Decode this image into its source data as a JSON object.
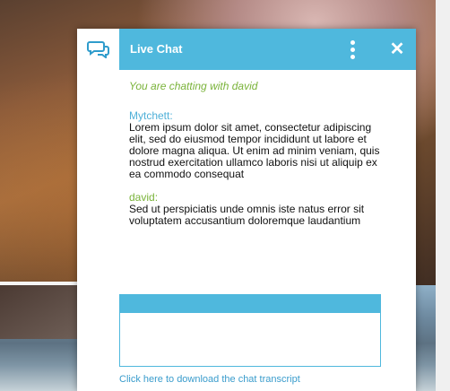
{
  "header": {
    "title": "Live Chat",
    "logo_icon": "chat-bubbles-icon",
    "menu_icon": "vertical-dots-icon",
    "close_icon": "close-icon",
    "close_glyph": "✕"
  },
  "chat": {
    "status": "You are chatting with david",
    "messages": [
      {
        "sender": "Mytchett:",
        "text": "Lorem ipsum dolor sit amet, consectetur adipiscing elit, sed do eiusmod tempor incididunt ut labore et dolore magna aliqua. Ut enim ad minim veniam, quis nostrud exercitation ullamco laboris nisi ut aliquip ex ea commodo consequat"
      },
      {
        "sender": "david:",
        "text": "Sed ut perspiciatis unde omnis iste natus error sit voluptatem accusantium doloremque laudantium"
      }
    ]
  },
  "input": {
    "placeholder": ""
  },
  "footer": {
    "transcript_link": "Click here to download the chat transcript"
  },
  "colors": {
    "accent": "#4fb8dd",
    "user_name": "#7ab33a",
    "agent_name": "#4fb0d8"
  }
}
